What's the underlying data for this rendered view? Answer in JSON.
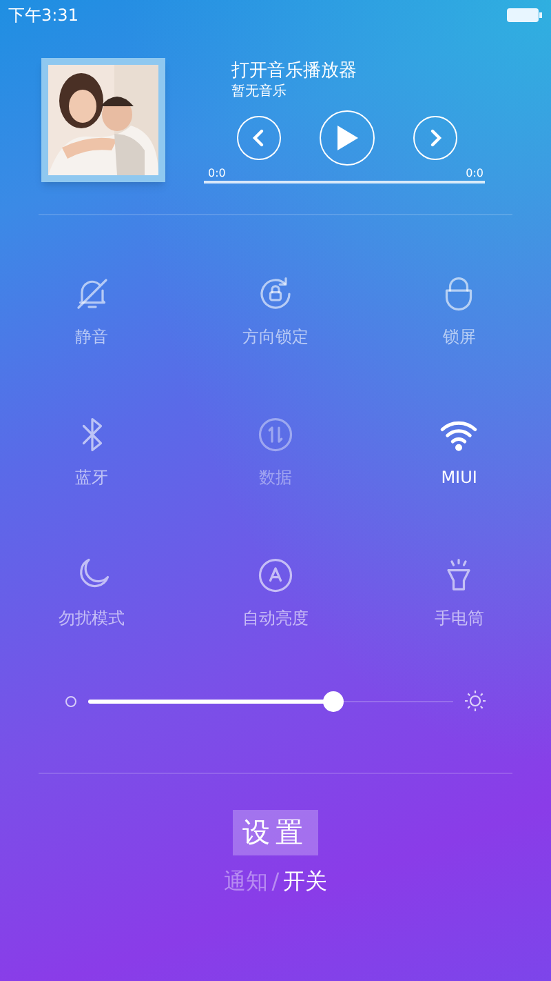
{
  "status_bar": {
    "time": "下午3:31"
  },
  "player": {
    "title": "打开音乐播放器",
    "subtitle": "暂无音乐",
    "playing": false,
    "elapsed": "0:0",
    "duration": "0:0"
  },
  "toggles": [
    {
      "kind": "mute",
      "label": "静音",
      "on": false,
      "disabled": false
    },
    {
      "kind": "rotation-lock",
      "label": "方向锁定",
      "on": false,
      "disabled": false
    },
    {
      "kind": "lock",
      "label": "锁屏",
      "on": false,
      "disabled": false
    },
    {
      "kind": "bluetooth",
      "label": "蓝牙",
      "on": false,
      "disabled": false
    },
    {
      "kind": "data",
      "label": "数据",
      "on": false,
      "disabled": true
    },
    {
      "kind": "wifi",
      "label": "MIUI",
      "on": true,
      "disabled": false
    },
    {
      "kind": "moon",
      "label": "勿扰模式",
      "on": false,
      "disabled": false
    },
    {
      "kind": "auto-brightness",
      "label": "自动亮度",
      "on": false,
      "disabled": false
    },
    {
      "kind": "flashlight",
      "label": "手电筒",
      "on": false,
      "disabled": false
    }
  ],
  "brightness": {
    "level": 0.67
  },
  "settings_button": "设置",
  "tabs": [
    {
      "label": "通知",
      "selected": false
    },
    {
      "label": "开关",
      "selected": true
    }
  ],
  "tab_separator": "/"
}
